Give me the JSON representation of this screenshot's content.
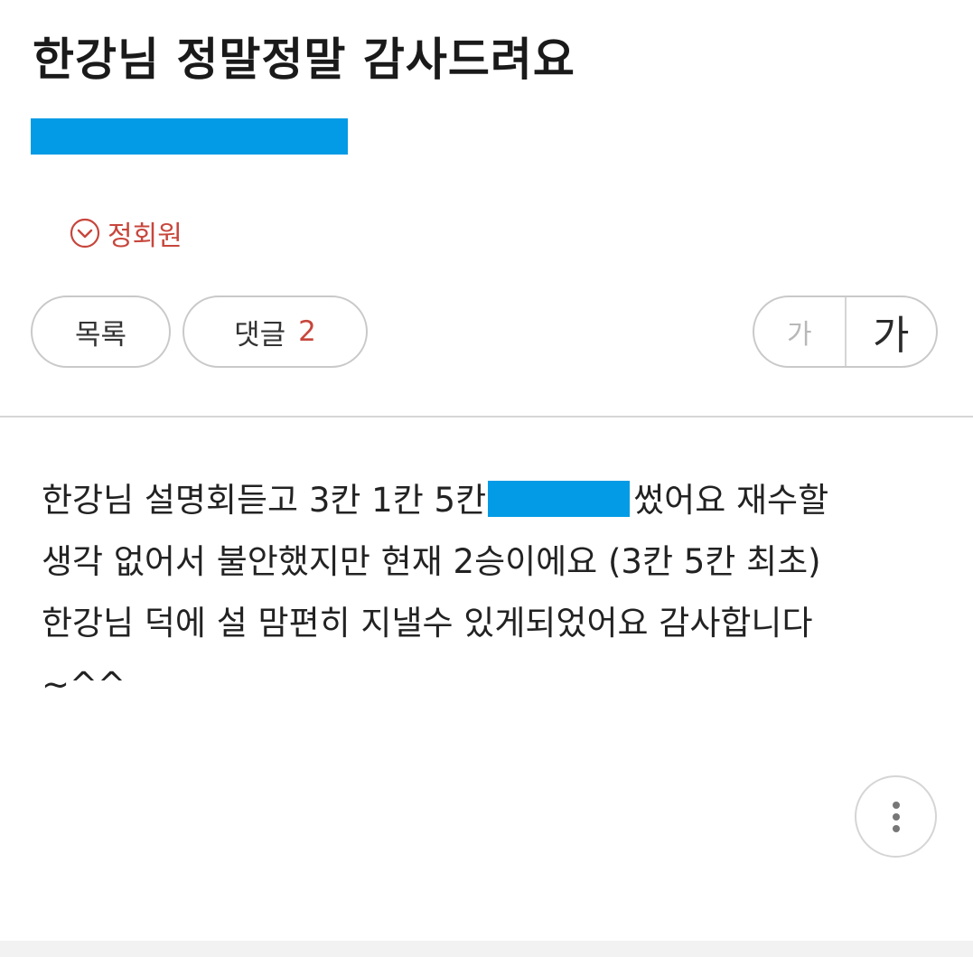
{
  "post": {
    "title": "한강님 정말정말 감사드려요",
    "author_badge": "정회원",
    "body_lines": [
      {
        "before": "한강님 설명회듣고 3칸 1칸 5칸",
        "after": "썼어요 재수할"
      },
      "생각 없어서 불안했지만 현재 2승이에요 (3칸 5칸 최초)",
      "한강님 덕에 설 맘편히 지낼수 있게되었어요 감사합니다",
      "~^^"
    ]
  },
  "toolbar": {
    "list_label": "목록",
    "comment_label": "댓글",
    "comment_count": "2",
    "font_small_label": "가",
    "font_large_label": "가"
  },
  "icons": {
    "member_badge": "chevron-down-circle-icon",
    "more": "more-vertical-icon"
  },
  "colors": {
    "accent_red": "#c7463c",
    "redaction_blue": "#039be5",
    "border_gray": "#c9c9c9"
  }
}
